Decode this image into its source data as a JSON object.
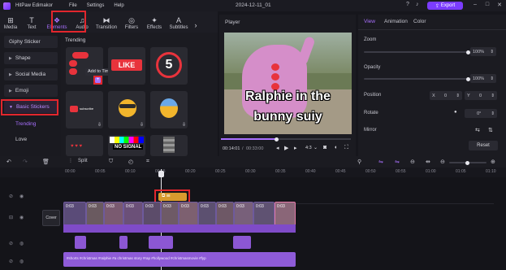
{
  "app": {
    "name": "HitPaw Edimakor",
    "menu": [
      "File",
      "Settings",
      "Help"
    ],
    "project_title": "2024-12-11_01",
    "export_label": "Export"
  },
  "toolbar": {
    "items": [
      {
        "label": "Media",
        "icon": "media-icon"
      },
      {
        "label": "Text",
        "icon": "text-icon"
      },
      {
        "label": "Elements",
        "icon": "elements-icon"
      },
      {
        "label": "Audio",
        "icon": "audio-icon"
      },
      {
        "label": "Transition",
        "icon": "transition-icon"
      },
      {
        "label": "Filters",
        "icon": "filters-icon"
      },
      {
        "label": "Effects",
        "icon": "effects-icon"
      },
      {
        "label": "Subtitles",
        "icon": "subtitles-icon"
      }
    ],
    "active": "Elements"
  },
  "sidebar": {
    "items": [
      "Giphy Sticker",
      "Shape",
      "Social Media",
      "Emoji",
      "Basic Stickers"
    ],
    "active": "Basic Stickers",
    "subitems": [
      "Trending",
      "Love"
    ],
    "active_sub": "Trending"
  },
  "stickers": {
    "section_title": "Trending",
    "tooltip": "Add to Timeline",
    "tile_texts": {
      "like": "LIKE",
      "five": "5",
      "no_signal": "NO SIGNAL",
      "subscribe": "subscribe",
      "bubble": "Like"
    }
  },
  "player": {
    "label": "Player",
    "caption_line1": "Ralphie in the",
    "caption_line2": "bunny suiy",
    "time_current": "00:14:01",
    "time_total": "00:33:00",
    "aspect": "4:3",
    "progress": 0.42
  },
  "properties": {
    "tabs": [
      "View",
      "Animation",
      "Color"
    ],
    "active_tab": "View",
    "zoom_label": "Zoom",
    "zoom_value": "100%",
    "zoom_level": 1.0,
    "opacity_label": "Opacity",
    "opacity_value": "100%",
    "opacity_level": 1.0,
    "position_label": "Position",
    "pos_x_label": "X",
    "pos_x": "0",
    "pos_y_label": "Y",
    "pos_y": "0",
    "rotate_label": "Rotate",
    "rotate_value": "0°",
    "mirror_label": "Mirror",
    "reset_label": "Reset"
  },
  "timeline": {
    "split_label": "Split",
    "ruler_ticks": [
      "00:00",
      "00:05",
      "00:10",
      "00:15",
      "00:20",
      "00:25",
      "00:30",
      "00:35",
      "00:40",
      "00:45",
      "00:50",
      "00:55",
      "01:00",
      "01:05",
      "01:10"
    ],
    "cover_label": "Cover",
    "clip_durations": [
      "0:03",
      "0:03",
      "0:03",
      "0:03",
      "0:03",
      "0:03",
      "0:03",
      "0:03",
      "0:03",
      "0:03",
      "0:03",
      "0:03"
    ],
    "audio_caption": "#shorts #christmas #ralphie #a christmas story #rap #hollywood #christmasmovie #fyp"
  },
  "colors": {
    "accent": "#7b3cff",
    "highlight_red": "#e2262d",
    "panel": "#1b1b21"
  }
}
